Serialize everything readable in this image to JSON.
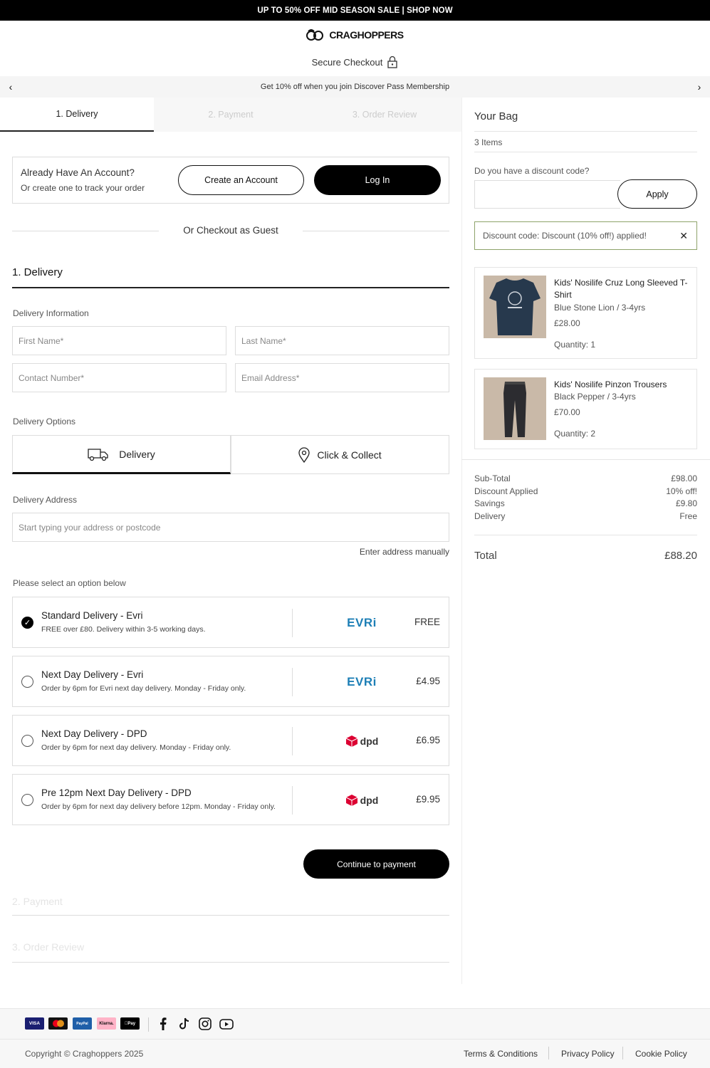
{
  "promo": {
    "text": "UP TO 50% OFF MID SEASON SALE | SHOP NOW"
  },
  "header": {
    "brand": "CRAGHOPPERS",
    "secure": "Secure Checkout"
  },
  "strip": {
    "text": "Get 10% off when you join Discover Pass Membership"
  },
  "steps": [
    "1. Delivery",
    "2. Payment",
    "3. Order Review"
  ],
  "account": {
    "title": "Already Have An Account?",
    "subtitle": "Or create one to track your order",
    "create_label": "Create an Account",
    "login_label": "Log In"
  },
  "guest_label": "Or Checkout as Guest",
  "delivery": {
    "heading": "1. Delivery",
    "info_label": "Delivery Information",
    "fields": {
      "first": "First Name*",
      "last": "Last Name*",
      "contact": "Contact Number*",
      "email": "Email Address*"
    },
    "options_label": "Delivery Options",
    "option_delivery": "Delivery",
    "option_collect": "Click & Collect",
    "address_label": "Delivery Address",
    "address_placeholder": "Start typing your address or postcode",
    "manual_link": "Enter address manually",
    "select_label": "Please select an option below",
    "methods": [
      {
        "title": "Standard Delivery - Evri",
        "desc": "FREE over £80. Delivery within 3-5 working days.",
        "carrier": "EVRi",
        "price": "FREE",
        "selected": true
      },
      {
        "title": "Next Day Delivery - Evri",
        "desc": "Order by 6pm for Evri next day delivery. Monday - Friday only.",
        "carrier": "EVRi",
        "price": "£4.95",
        "selected": false
      },
      {
        "title": "Next Day Delivery - DPD",
        "desc": "Order by 6pm for next day delivery. Monday - Friday only.",
        "carrier": "dpd",
        "price": "£6.95",
        "selected": false
      },
      {
        "title": "Pre 12pm Next Day Delivery - DPD",
        "desc": "Order by 6pm for next day delivery before 12pm. Monday - Friday only.",
        "carrier": "dpd",
        "price": "£9.95",
        "selected": false
      }
    ],
    "continue_label": "Continue to payment"
  },
  "accordion": {
    "payment": "2. Payment",
    "review": "3. Order Review"
  },
  "bag": {
    "title": "Your Bag",
    "count": "3 Items",
    "discount_label": "Do you have a discount code?",
    "apply_label": "Apply",
    "discount_msg": "Discount code: Discount (10% off!) applied!",
    "items": [
      {
        "name": "Kids' Nosilife Cruz Long Sleeved T-Shirt",
        "variant": "Blue Stone Lion / 3-4yrs",
        "price": "£28.00",
        "qty": "Quantity: 1"
      },
      {
        "name": "Kids' Nosilife Pinzon Trousers",
        "variant": "Black Pepper / 3-4yrs",
        "price": "£70.00",
        "qty": "Quantity: 2"
      }
    ],
    "summary": [
      {
        "label": "Sub-Total",
        "value": "£98.00"
      },
      {
        "label": "Discount Applied",
        "value": "10% off!"
      },
      {
        "label": "Savings",
        "value": "£9.80"
      },
      {
        "label": "Delivery",
        "value": "Free"
      }
    ],
    "total_label": "Total",
    "total_value": "£88.20"
  },
  "footer": {
    "payments": [
      "VISA",
      "Mastercard",
      "PayPal",
      "Klarna.",
      "Apple Pay"
    ],
    "payment_icons": [
      "visa-icon",
      "mastercard-icon",
      "paypal-icon",
      "klarna-icon",
      "apple-pay-icon"
    ],
    "social_icons": [
      "facebook-icon",
      "tiktok-icon",
      "instagram-icon",
      "youtube-icon"
    ],
    "copyright": "Copyright © Craghoppers 2025",
    "links": [
      "Terms & Conditions",
      "Privacy Policy",
      "Cookie Policy"
    ]
  },
  "colors": {
    "accent": "#000000",
    "evri": "#1d7fb6",
    "dpd": "#dc0032",
    "discount_border": "#8ea36a"
  }
}
